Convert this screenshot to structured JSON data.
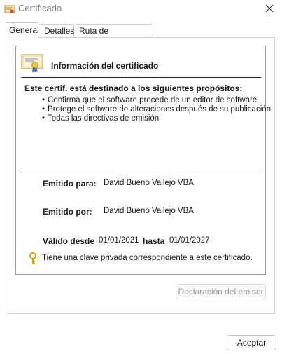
{
  "window": {
    "title": "Certificado"
  },
  "tabs": [
    {
      "label": "General",
      "active": true
    },
    {
      "label": "Detalles",
      "active": false
    },
    {
      "label": "Ruta de certificación",
      "active": false
    }
  ],
  "certificate": {
    "heading": "Información del certificado",
    "purposes_title": "Este certif. está destinado a los siguientes propósitos:",
    "purposes": [
      "Confirma que el software procede de un editor de software",
      "Protege el software de alteraciones después de su publicación",
      "Todas las directivas de emisión"
    ],
    "issued_to_label": "Emitido para:",
    "issued_to": "David Bueno Vallejo VBA",
    "issued_by_label": "Emitido por:",
    "issued_by": "David Bueno Vallejo VBA",
    "valid_from_label": "Válido desde",
    "valid_from": "01/01/2021",
    "valid_to_label": "hasta",
    "valid_to": "01/01/2027",
    "private_key_text": "Tiene una clave privada correspondiente a este certificado."
  },
  "buttons": {
    "issuer_statement": "Declaración del emisor",
    "accept": "Aceptar"
  },
  "icons": {
    "title": "certificate-icon",
    "close": "close-icon",
    "cert": "certificate-icon",
    "key": "key-icon"
  },
  "colors": {
    "key": "#d9a400",
    "rule": "#222222"
  }
}
